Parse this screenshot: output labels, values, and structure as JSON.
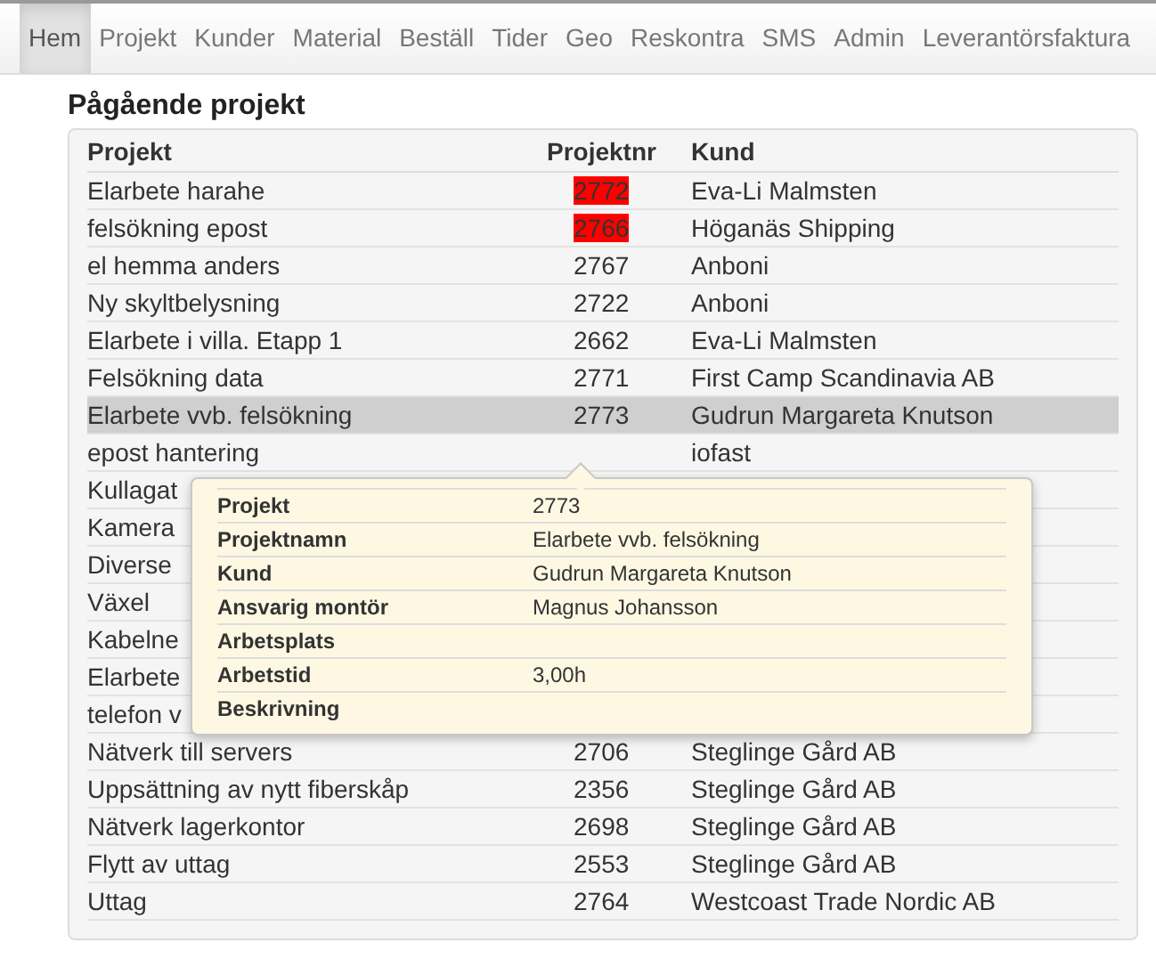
{
  "nav": [
    {
      "label": "Hem",
      "selected": true
    },
    {
      "label": "Projekt",
      "selected": false
    },
    {
      "label": "Kunder",
      "selected": false
    },
    {
      "label": "Material",
      "selected": false
    },
    {
      "label": "Beställ",
      "selected": false
    },
    {
      "label": "Tider",
      "selected": false
    },
    {
      "label": "Geo",
      "selected": false
    },
    {
      "label": "Reskontra",
      "selected": false
    },
    {
      "label": "SMS",
      "selected": false
    },
    {
      "label": "Admin",
      "selected": false
    },
    {
      "label": "Leverantörsfaktura",
      "selected": false
    }
  ],
  "title": "Pågående projekt",
  "table": {
    "columns": [
      "Projekt",
      "Projektnr",
      "Kund"
    ],
    "rows": [
      {
        "project": "Elarbete harahe",
        "number": "2772",
        "customer": "Eva-Li Malmsten",
        "overdue": true,
        "selected": false
      },
      {
        "project": "felsökning epost",
        "number": "2766",
        "customer": "Höganäs Shipping",
        "overdue": true,
        "selected": false
      },
      {
        "project": "el hemma anders",
        "number": "2767",
        "customer": "Anboni",
        "overdue": false,
        "selected": false
      },
      {
        "project": "Ny skyltbelysning",
        "number": "2722",
        "customer": "Anboni",
        "overdue": false,
        "selected": false
      },
      {
        "project": "Elarbete i villa. Etapp 1",
        "number": "2662",
        "customer": "Eva-Li Malmsten",
        "overdue": false,
        "selected": false
      },
      {
        "project": "Felsökning data",
        "number": "2771",
        "customer": "First Camp Scandinavia AB",
        "overdue": false,
        "selected": false
      },
      {
        "project": "Elarbete vvb. felsökning",
        "number": "2773",
        "customer": "Gudrun Margareta Knutson",
        "overdue": false,
        "selected": true
      },
      {
        "project": "epost hantering",
        "customer": "iofast",
        "selected": false
      },
      {
        "project": "Kullagat",
        "selected": false
      },
      {
        "project": "Kamera",
        "selected": false
      },
      {
        "project": "Diverse",
        "selected": false
      },
      {
        "project": "Växel",
        "selected": false
      },
      {
        "project": "Kabelne",
        "selected": false
      },
      {
        "project": "Elarbete",
        "selected": false
      },
      {
        "project": "telefon v",
        "selected": false
      },
      {
        "project": "Nätverk till servers",
        "number": "2706",
        "customer": "Steglinge Gård AB",
        "overdue": false,
        "selected": false
      },
      {
        "project": "Uppsättning av nytt fiberskåp",
        "number": "2356",
        "customer": "Steglinge Gård AB",
        "overdue": false,
        "selected": false
      },
      {
        "project": "Nätverk lagerkontor",
        "number": "2698",
        "customer": "Steglinge Gård AB",
        "overdue": false,
        "selected": false
      },
      {
        "project": "Flytt av uttag",
        "number": "2553",
        "customer": "Steglinge Gård AB",
        "overdue": false,
        "selected": false
      },
      {
        "project": "Uttag",
        "number": "2764",
        "customer": "Westcoast Trade Nordic AB",
        "overdue": false,
        "selected": false
      }
    ]
  },
  "tooltip": {
    "fields": [
      {
        "label": "Projekt",
        "value": "2773"
      },
      {
        "label": "Projektnamn",
        "value": "Elarbete vvb. felsökning"
      },
      {
        "label": "Kund",
        "value": "Gudrun Margareta Knutson"
      },
      {
        "label": "Ansvarig montör",
        "value": "Magnus Johansson"
      },
      {
        "label": "Arbetsplats"
      },
      {
        "label": "Arbetstid",
        "value": "3,00h"
      },
      {
        "label": "Beskrivning"
      }
    ]
  }
}
